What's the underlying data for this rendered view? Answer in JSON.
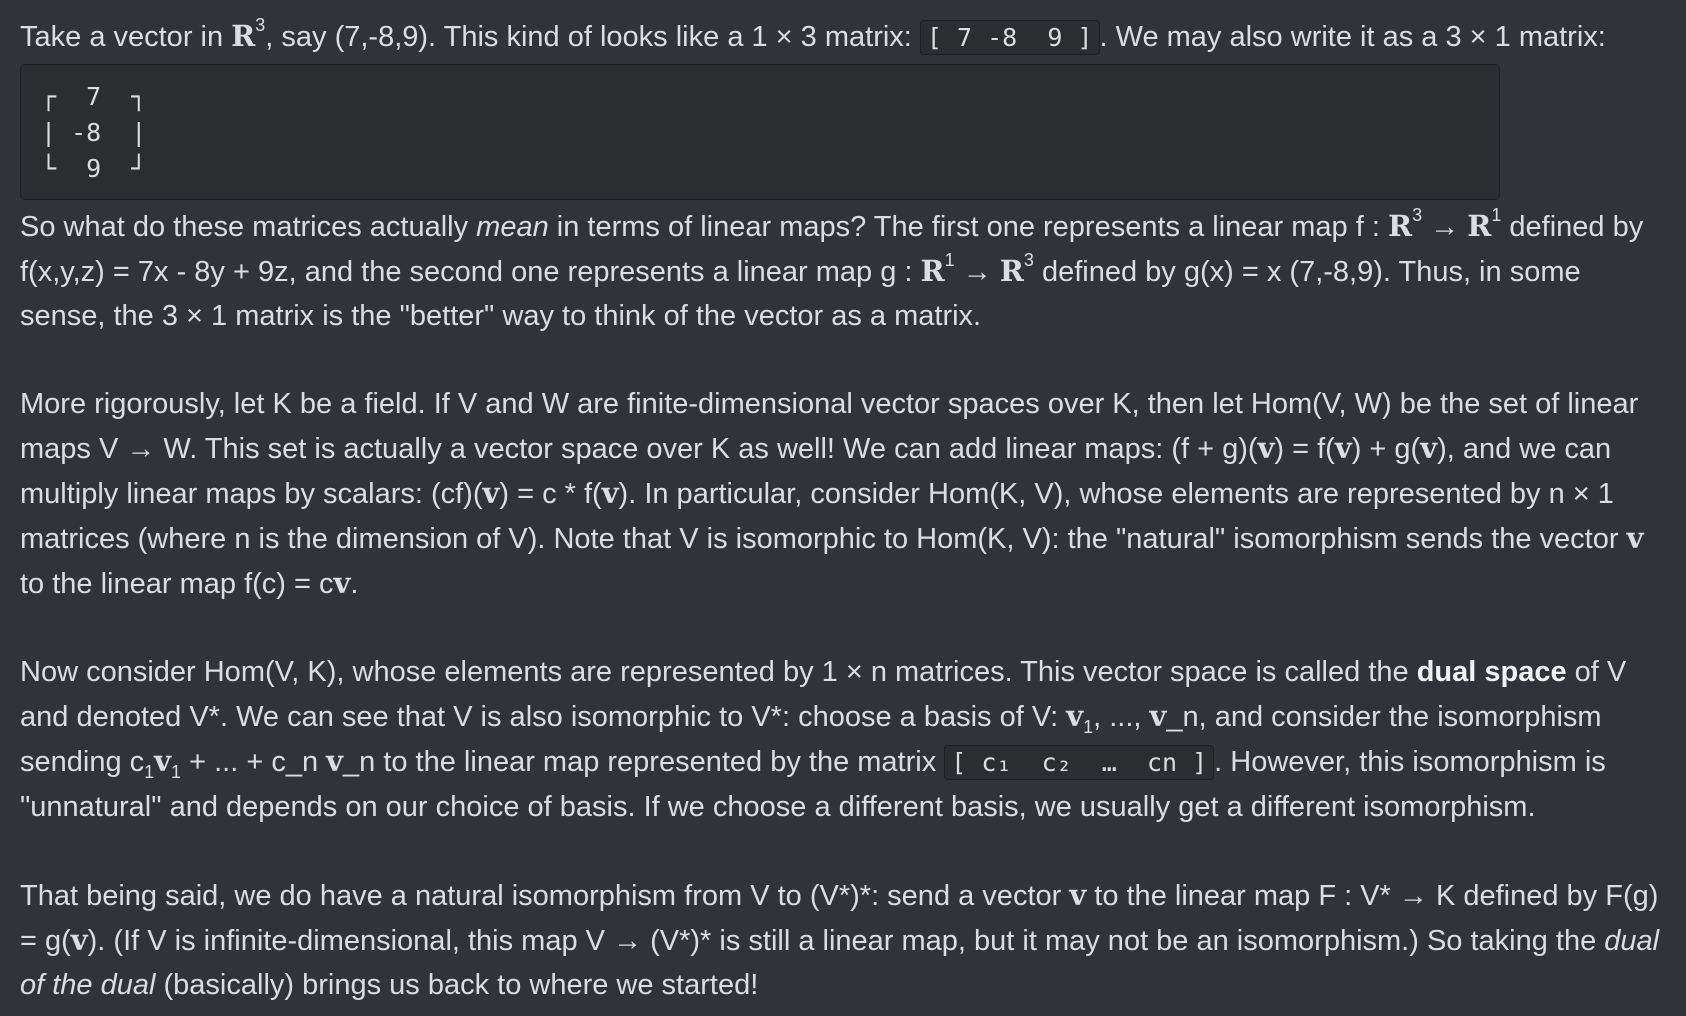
{
  "p1": {
    "t1": "Take a vector in ",
    "R": "R",
    "s3": "3",
    "t2": ", say (7,-8,9). This kind of looks like a 1 × 3 matrix: ",
    "code_row": "[ 7 -8  9 ]",
    "t3": ". We may also write it as a 3 × 1 matrix:"
  },
  "code_block": "┌  7  ┐\n| -8  |\n└  9  ┘",
  "p2": {
    "t1": "So what do these matrices actually ",
    "em": "mean",
    "t2": " in terms of linear maps? The first one represents a linear map f : ",
    "R1": "R",
    "s1": "3",
    "arrow1": " → ",
    "R2": "R",
    "s2": "1",
    "t3": " defined by f(x,y,z) = 7x - 8y + 9z, and the second one represents a linear map g : ",
    "R3": "R",
    "s3": "1",
    "arrow2": " → ",
    "R4": "R",
    "s4": "3",
    "t4": " defined by g(x) = x (7,-8,9). Thus, in some sense, the 3 × 1 matrix is the \"better\" way to think of the vector as a matrix."
  },
  "p3": {
    "t1": "More rigorously, let K be a field. If V and W are finite-dimensional vector spaces over K, then let Hom(V, W) be the set of linear maps V → W. This set is actually a vector space over K as well! We can add linear maps: (f + g)(",
    "v1": "v",
    "t2": ") = f(",
    "v2": "v",
    "t3": ") + g(",
    "v3": "v",
    "t4": "), and we can multiply linear maps by scalars: (cf)(",
    "v4": "v",
    "t5": ") = c * f(",
    "v5": "v",
    "t6": "). In particular, consider Hom(K, V), whose elements are represented by n × 1 matrices (where n is the dimension of V). Note that V is isomorphic to Hom(K, V): the \"natural\" isomorphism sends the vector ",
    "v6": "v",
    "t7": " to the linear map f(c) = c",
    "v7": "v",
    "t8": "."
  },
  "p4": {
    "t1": "Now consider Hom(V, K), whose elements are represented by 1 × n matrices. This vector space is called the ",
    "strong": "dual space",
    "t2": " of V and denoted V*. We can see that V is also isomorphic to V*: choose a basis of V: ",
    "v1": "v",
    "sub1": "1",
    "t3": ", ..., ",
    "v2": "v",
    "t4": "_n, and consider the isomorphism sending c",
    "sub2": "1",
    "v3": "v",
    "sub3": "1",
    "t5": " + ... + c_n ",
    "v4": "v",
    "t6": "_n to the linear map represented by the matrix ",
    "code_row": "[ c₁  c₂  …  cn ]",
    "t7": ". However, this isomorphism is \"unnatural\" and depends on our choice of basis. If we choose a different basis, we usually get a different isomorphism."
  },
  "p5": {
    "t1": "That being said, we do have a natural isomorphism from V to (V*)*: send a vector ",
    "v1": "v",
    "t2": " to the linear map F : V* → K defined by F(g) = g(",
    "v2": "v",
    "t3": "). (If V is infinite-dimensional, this map V → (V*)* is still a linear map, but it may not be an isomorphism.) So taking the ",
    "em": "dual of the dual",
    "t4": " (basically) brings us back to where we started!"
  }
}
